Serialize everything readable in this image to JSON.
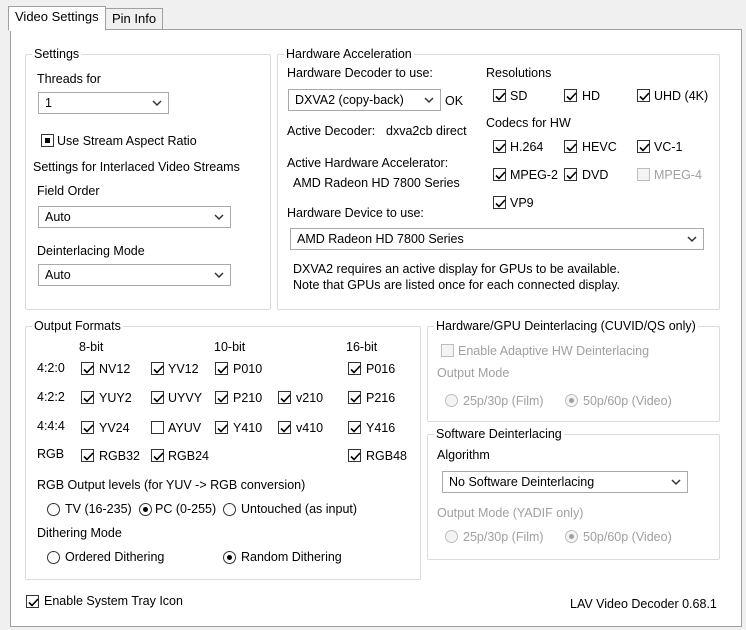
{
  "tabs": [
    "Video Settings",
    "Pin Info"
  ],
  "settings": {
    "title": "Settings",
    "threads_label": "Threads for",
    "threads_value": "1",
    "stream_aspect": "Use Stream Aspect Ratio",
    "interlaced_label": "Settings for Interlaced Video Streams",
    "field_order_label": "Field Order",
    "field_order_value": "Auto",
    "deint_mode_label": "Deinterlacing Mode",
    "deint_mode_value": "Auto"
  },
  "hw": {
    "title": "Hardware Acceleration",
    "decoder_label": "Hardware Decoder to use:",
    "decoder_value": "DXVA2 (copy-back)",
    "decoder_status": "OK",
    "active_decoder_label": "Active Decoder:",
    "active_decoder_value": "dxva2cb direct",
    "active_accel_label": "Active Hardware Accelerator:",
    "active_accel_value": "AMD Radeon HD 7800 Series",
    "device_label": "Hardware Device to use:",
    "device_value": "AMD Radeon HD 7800 Series",
    "note1": "DXVA2 requires an active display for GPUs to be available.",
    "note2": "Note that GPUs are listed once for each connected display.",
    "resolutions_label": "Resolutions",
    "res": [
      "SD",
      "HD",
      "UHD (4K)"
    ],
    "codecs_label": "Codecs for HW",
    "codecs": [
      "H.264",
      "HEVC",
      "VC-1",
      "MPEG-2",
      "DVD",
      "MPEG-4",
      "VP9"
    ]
  },
  "output": {
    "title": "Output Formats",
    "headers": [
      "8-bit",
      "10-bit",
      "16-bit"
    ],
    "rows": [
      "4:2:0",
      "4:2:2",
      "4:4:4",
      "RGB"
    ],
    "formats": [
      "NV12",
      "YV12",
      "P010",
      "P016",
      "YUY2",
      "UYVY",
      "P210",
      "v210",
      "P216",
      "YV24",
      "AYUV",
      "Y410",
      "v410",
      "Y416",
      "RGB32",
      "RGB24",
      "RGB48"
    ],
    "rgb_levels_label": "RGB Output levels (for YUV -> RGB conversion)",
    "rgb_levels": [
      "TV (16-235)",
      "PC (0-255)",
      "Untouched (as input)"
    ],
    "dithering_label": "Dithering Mode",
    "dithering": [
      "Ordered Dithering",
      "Random Dithering"
    ]
  },
  "hwdeint": {
    "title": "Hardware/GPU Deinterlacing (CUVID/QS only)",
    "enable": "Enable Adaptive HW Deinterlacing",
    "output_mode": "Output Mode",
    "opt1": "25p/30p (Film)",
    "opt2": "50p/60p (Video)"
  },
  "swdeint": {
    "title": "Software Deinterlacing",
    "algorithm_label": "Algorithm",
    "algorithm_value": "No Software Deinterlacing",
    "output_mode": "Output Mode (YADIF only)",
    "opt1": "25p/30p (Film)",
    "opt2": "50p/60p (Video)"
  },
  "footer": {
    "tray": "Enable System Tray Icon",
    "version": "LAV Video Decoder 0.68.1"
  }
}
